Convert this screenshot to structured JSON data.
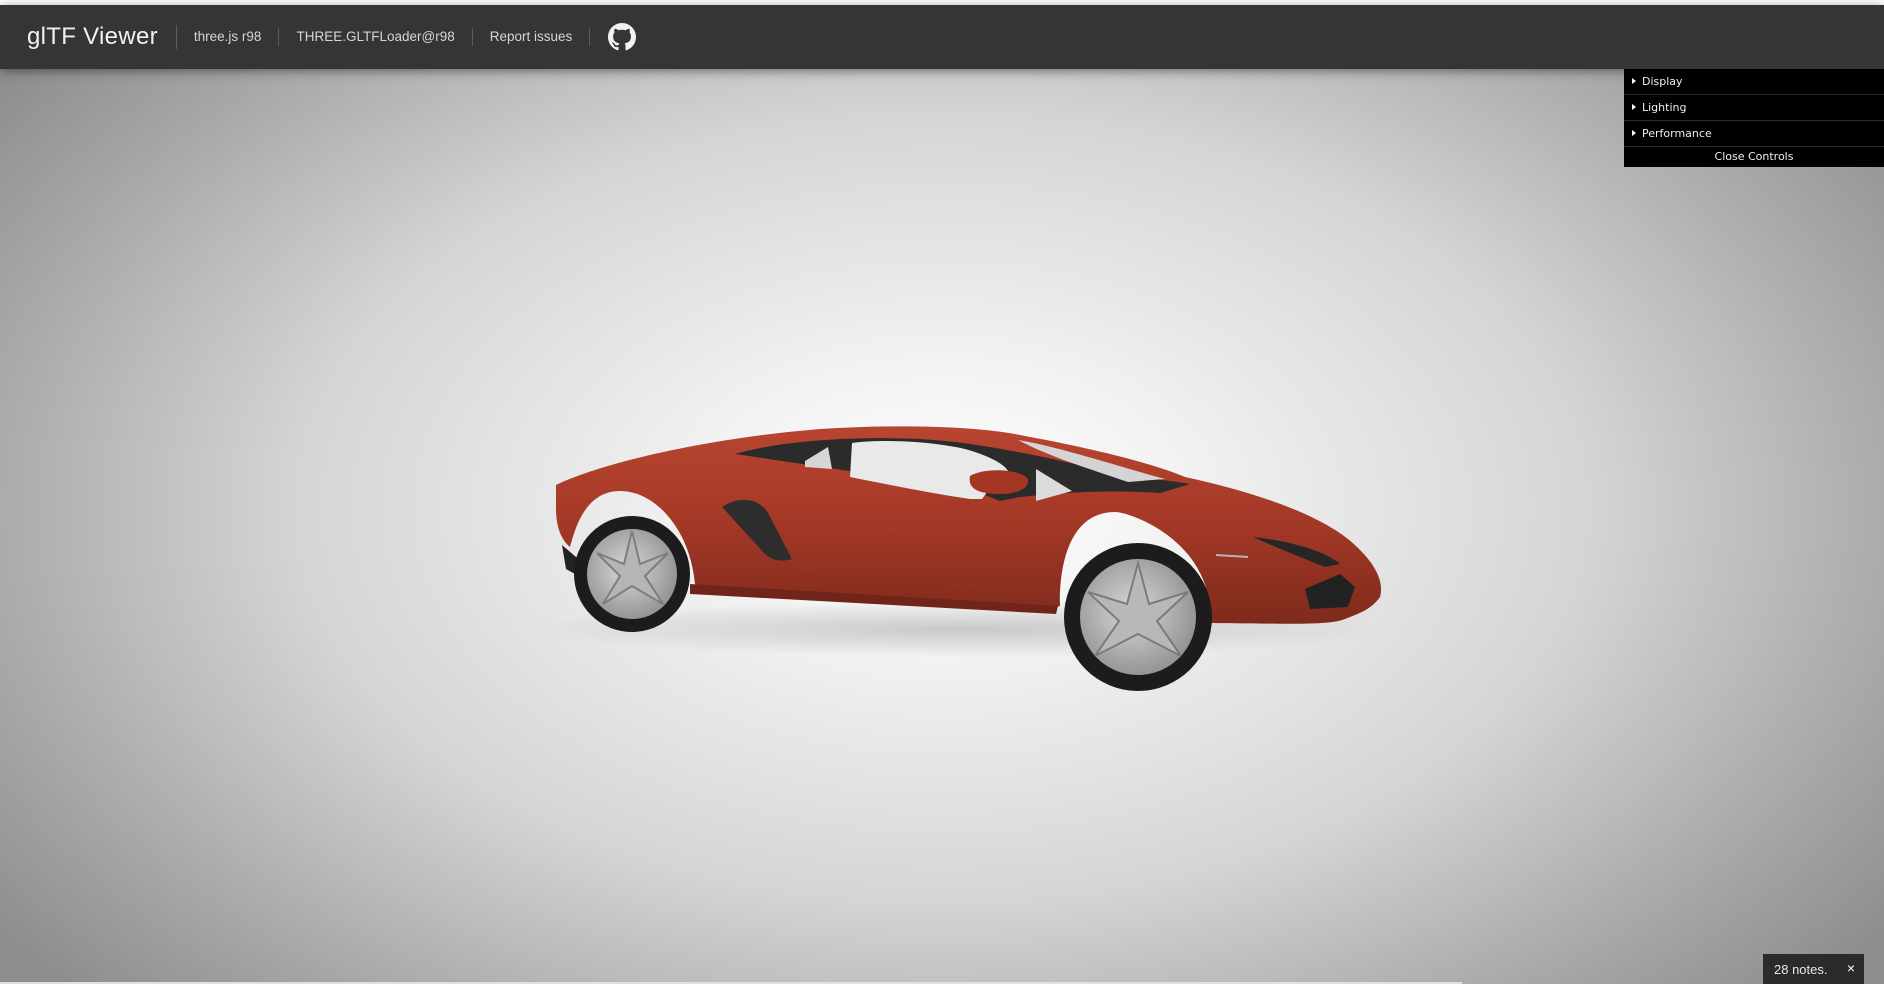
{
  "header": {
    "title": "glTF Viewer",
    "links": [
      {
        "label": "three.js r98"
      },
      {
        "label": "THREE.GLTFLoader@r98"
      },
      {
        "label": "Report issues"
      }
    ],
    "github_icon": "github-icon"
  },
  "controls": {
    "folders": [
      {
        "label": "Display"
      },
      {
        "label": "Lighting"
      },
      {
        "label": "Performance"
      }
    ],
    "close_label": "Close Controls"
  },
  "notice": {
    "text": "28 notes.",
    "close_glyph": "×"
  },
  "colors": {
    "header_bg": "#353535",
    "car_body": "#a93a28",
    "panel_bg": "#000000"
  }
}
